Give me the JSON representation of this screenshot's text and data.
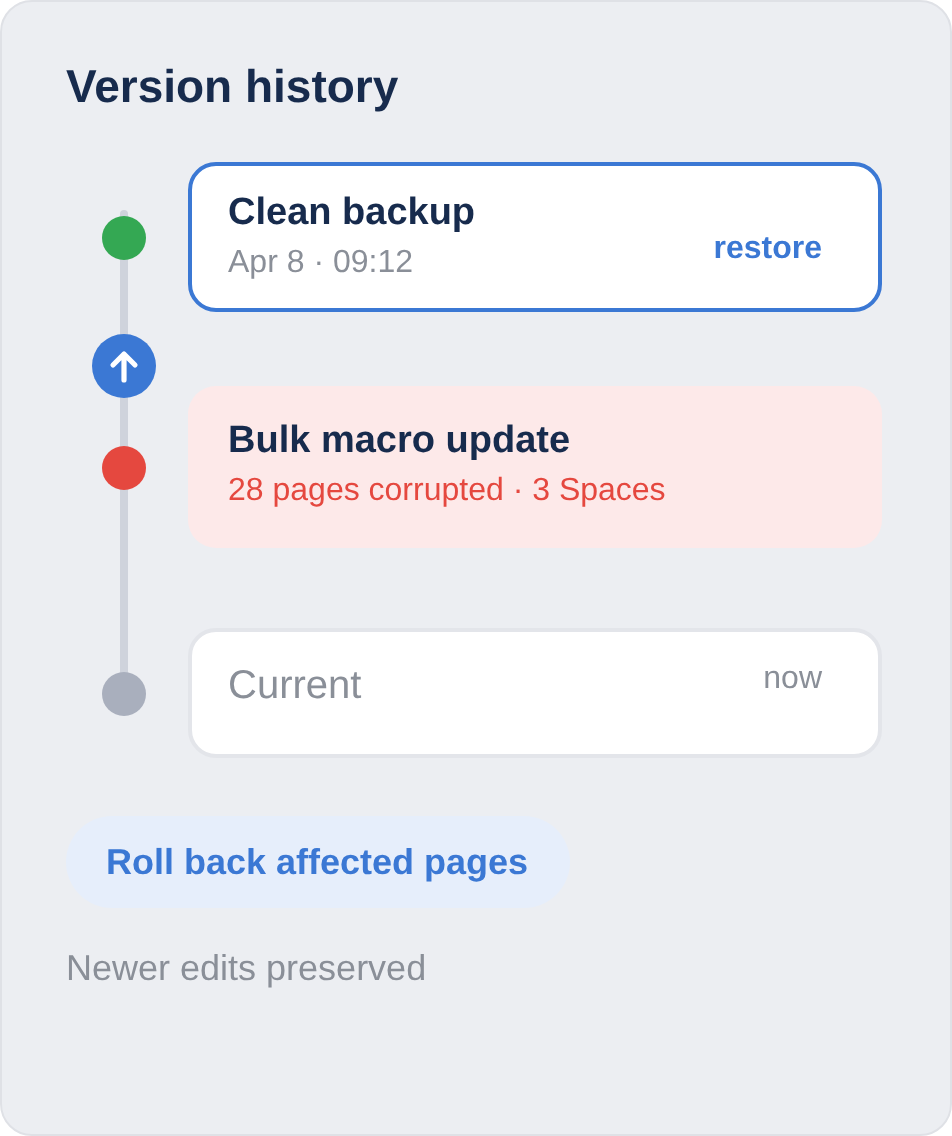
{
  "title": "Version history",
  "versions": [
    {
      "kind": "backup",
      "title": "Clean backup",
      "subtitle": "Apr 8 · 09:12",
      "action": "restore",
      "color": "#34a853",
      "selected": true
    },
    {
      "kind": "incident",
      "title": "Bulk macro update",
      "subtitle": "28 pages corrupted · 3 Spaces",
      "color": "#e5483f",
      "selected": false
    },
    {
      "kind": "current",
      "title": "Current",
      "time": "now",
      "color": "#a9afbd",
      "selected": false
    }
  ],
  "button": "Roll back affected pages",
  "footnote": "Newer edits preserved"
}
